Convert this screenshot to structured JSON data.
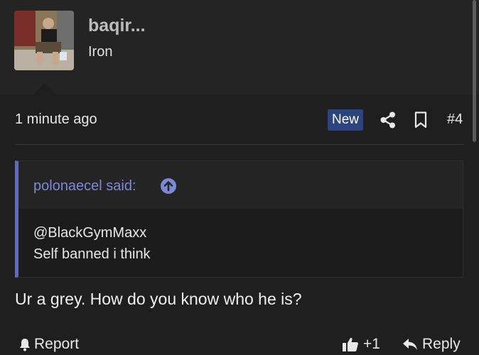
{
  "author": {
    "name": "baqir...",
    "title": "Iron"
  },
  "post": {
    "timestamp": "1 minute ago",
    "badge": "New",
    "number": "#4",
    "body": "Ur a grey. How do you know who he is?"
  },
  "quote": {
    "author_line": "polonaecel said:",
    "lines": [
      "@BlackGymMaxx",
      "Self banned i think"
    ]
  },
  "actions": {
    "report_label": "Report",
    "like_count": "+1",
    "reply_label": "Reply"
  },
  "icons": {
    "share": "share-icon",
    "bookmark": "bookmark-icon",
    "quote_jump": "arrow-up-circle-icon",
    "report": "bell-icon",
    "like": "thumbs-up-icon",
    "reply": "reply-arrow-icon"
  },
  "colors": {
    "accent": "#5c6bc0",
    "badge_bg": "#2b4480",
    "quote_author": "#7c8ad6"
  }
}
